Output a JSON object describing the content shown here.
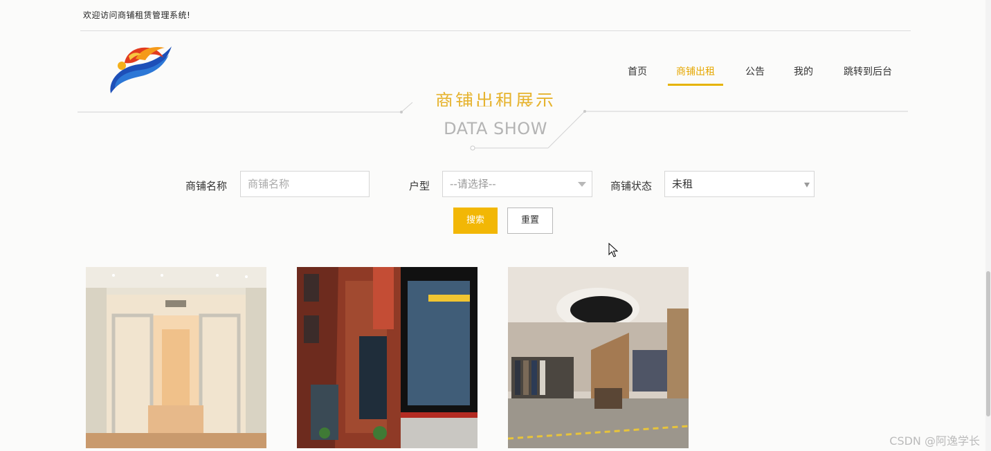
{
  "topbar": {
    "welcome": "欢迎访问商铺租赁管理系统!"
  },
  "nav": {
    "items": [
      {
        "label": "首页",
        "active": false
      },
      {
        "label": "商铺出租",
        "active": true
      },
      {
        "label": "公告",
        "active": false
      },
      {
        "label": "我的",
        "active": false
      },
      {
        "label": "跳转到后台",
        "active": false
      }
    ]
  },
  "section": {
    "title_cn": "商铺出租展示",
    "title_en": "DATA SHOW"
  },
  "search": {
    "name_label": "商铺名称",
    "name_placeholder": "商铺名称",
    "type_label": "户型",
    "type_placeholder": "--请选择--",
    "status_label": "商铺状态",
    "status_value": "未租",
    "search_button": "搜索",
    "reset_button": "重置"
  },
  "shops": [
    {
      "image": "bridal-boutique-storefront"
    },
    {
      "image": "brick-street-storefronts"
    },
    {
      "image": "clothing-store-interior"
    }
  ],
  "colors": {
    "accent": "#f2b705",
    "active_nav": "#e6a700"
  },
  "watermark": "CSDN @阿逸学长"
}
